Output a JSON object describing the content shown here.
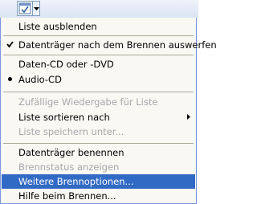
{
  "toolbar": {
    "button_icon": "checkmark-window-icon",
    "dropdown_icon": "chevron-down-icon"
  },
  "menu": {
    "items": [
      {
        "label": "Liste ausblenden"
      },
      {
        "label": "Datenträger nach dem Brennen auswerfen",
        "checked": true
      },
      {
        "label": "Daten-CD oder -DVD"
      },
      {
        "label": "Audio-CD",
        "selected": true
      },
      {
        "label": "Zufällige Wiedergabe für Liste",
        "disabled": true
      },
      {
        "label": "Liste sortieren nach",
        "submenu": true
      },
      {
        "label": "Liste speichern unter...",
        "disabled": true
      },
      {
        "label": "Datenträger benennen"
      },
      {
        "label": "Brennstatus anzeigen",
        "disabled": true
      },
      {
        "label": "Weitere Brennoptionen...",
        "highlighted": true
      },
      {
        "label": "Hilfe beim Brennen..."
      }
    ]
  },
  "colors": {
    "highlight": "#316ac5",
    "disabled_text": "#a7a6aa",
    "menu_background": "#f9f8f3"
  }
}
